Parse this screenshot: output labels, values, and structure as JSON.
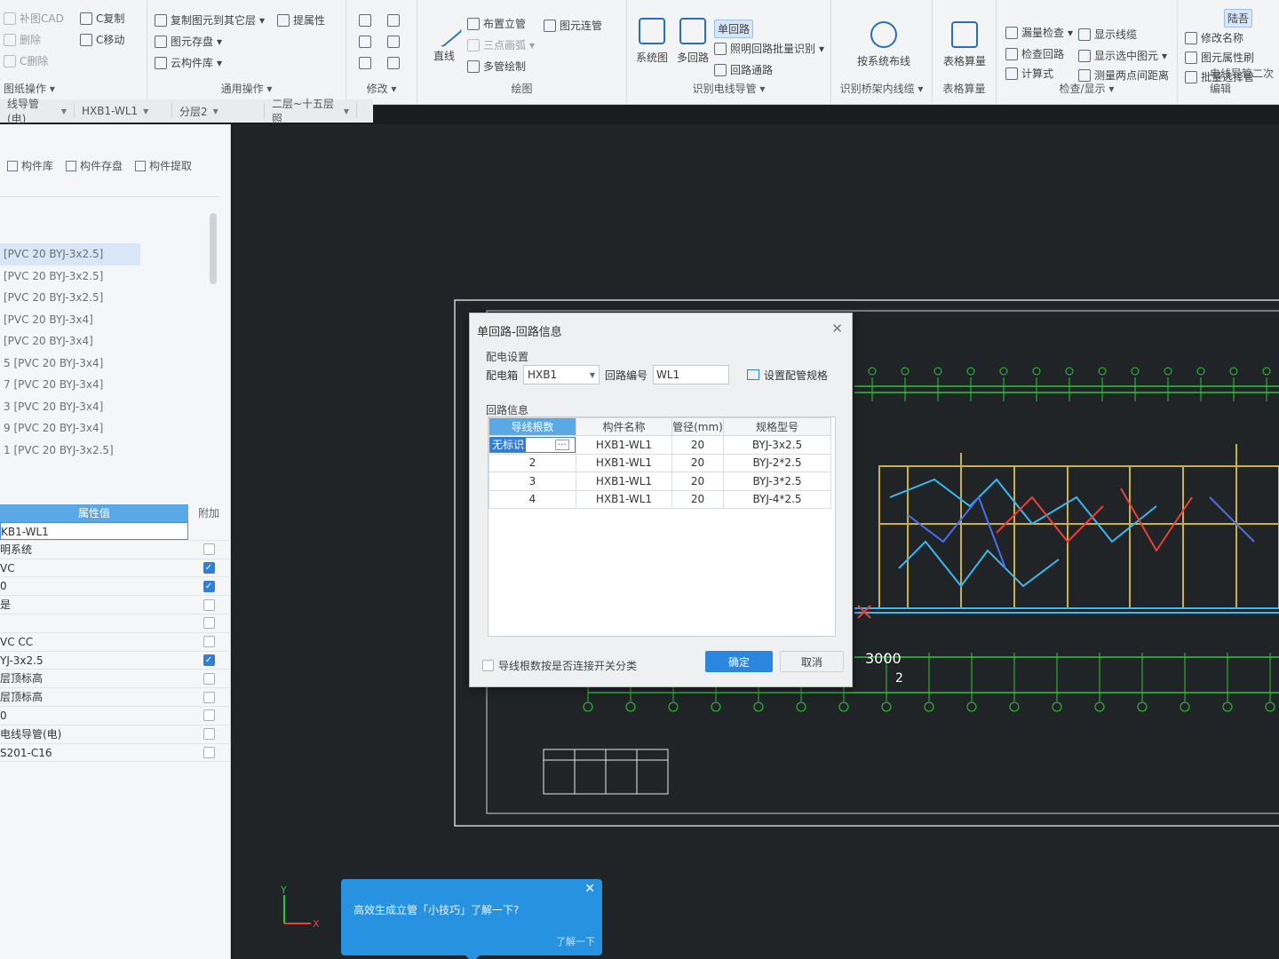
{
  "ribbon": {
    "col1": [
      "补图CAD",
      "删除",
      "C删除"
    ],
    "col2": [
      "C复制",
      "C移动"
    ],
    "col1_title": "图纸操作",
    "col3": [
      "复制图元到其它层",
      "图元存盘",
      "云构件库"
    ],
    "prop_btn": "提属性",
    "general_title": "通用操作",
    "modify_title": "修改",
    "draw": {
      "line": "直线",
      "items": [
        "布置立管",
        "三点画弧",
        "多管绘制"
      ],
      "connect": "图元连管",
      "title": "绘图"
    },
    "identify": {
      "system": "系统图",
      "multi": "多回路",
      "single": "单回路",
      "batch": "照明回路批量识别",
      "port": "回路通路",
      "title": "识别电线导管"
    },
    "tray": {
      "label": "按系统布线",
      "title": "识别桥架内线缆"
    },
    "table": {
      "label": "表格算量",
      "title": "表格算量"
    },
    "check": {
      "items": [
        "漏量检查",
        "检查回路",
        "计算式"
      ],
      "items2": [
        "显示线缆",
        "显示选中图元",
        "测量两点间距离"
      ],
      "title": "检查/显示"
    },
    "edit2": {
      "items": [
        "修改名称",
        "图元属性刷",
        "批量选择管"
      ],
      "title": "电线导管二次编辑",
      "corner": "陆吾"
    }
  },
  "filters": [
    "线导管(电)",
    "HXB1-WL1",
    "分层2",
    "二层~十五层照"
  ],
  "leftpanel": {
    "tabs": [
      "构件库",
      "构件存盘",
      "构件提取"
    ],
    "list": [
      "[PVC 20 BYJ-3x2.5]",
      "[PVC 20 BYJ-3x2.5]",
      "[PVC 20 BYJ-3x2.5]",
      "[PVC 20 BYJ-3x4]",
      "[PVC 20 BYJ-3x4]",
      "5 [PVC 20 BYJ-3x4]",
      "7 [PVC 20 BYJ-3x4]",
      "3 [PVC 20 BYJ-3x4]",
      "9 [PVC 20 BYJ-3x4]",
      "1 [PVC 20 BYJ-3x2.5]"
    ],
    "props_header": "属性值",
    "props_extra": "附加",
    "props": [
      {
        "v": "KB1-WL1",
        "c": null
      },
      {
        "v": "明系统",
        "c": false
      },
      {
        "v": "VC",
        "c": true
      },
      {
        "v": "0",
        "c": true
      },
      {
        "v": "是",
        "c": false
      },
      {
        "v": "",
        "c": false
      },
      {
        "v": "VC CC",
        "c": false
      },
      {
        "v": "YJ-3x2.5",
        "c": true
      },
      {
        "v": "层顶标高",
        "c": false
      },
      {
        "v": "层顶标高",
        "c": false
      },
      {
        "v": "0",
        "c": false
      },
      {
        "v": "电线导管(电)",
        "c": false
      },
      {
        "v": "S201-C16",
        "c": false
      }
    ]
  },
  "dialog": {
    "title": "单回路-回路信息",
    "section1": "配电设置",
    "box_label": "配电箱",
    "box_value": "HXB1",
    "circuit_label": "回路编号",
    "circuit_value": "WL1",
    "set_spec": "设置配管规格",
    "section2": "回路信息",
    "columns": [
      "导线根数",
      "构件名称",
      "管径(mm)",
      "规格型号"
    ],
    "rows": [
      [
        "无标识",
        "HXB1-WL1",
        "20",
        "BYJ-3x2.5"
      ],
      [
        "2",
        "HXB1-WL1",
        "20",
        "BYJ-2*2.5"
      ],
      [
        "3",
        "HXB1-WL1",
        "20",
        "BYJ-3*2.5"
      ],
      [
        "4",
        "HXB1-WL1",
        "20",
        "BYJ-4*2.5"
      ]
    ],
    "check_label": "导线根数按是否连接开关分类",
    "ok": "确定",
    "cancel": "取消"
  },
  "canvas": {
    "dim_text": "3000",
    "dim_small": "2"
  },
  "tip": {
    "text": "高效生成立管「小技巧」了解一下?",
    "button": "了解一下"
  }
}
